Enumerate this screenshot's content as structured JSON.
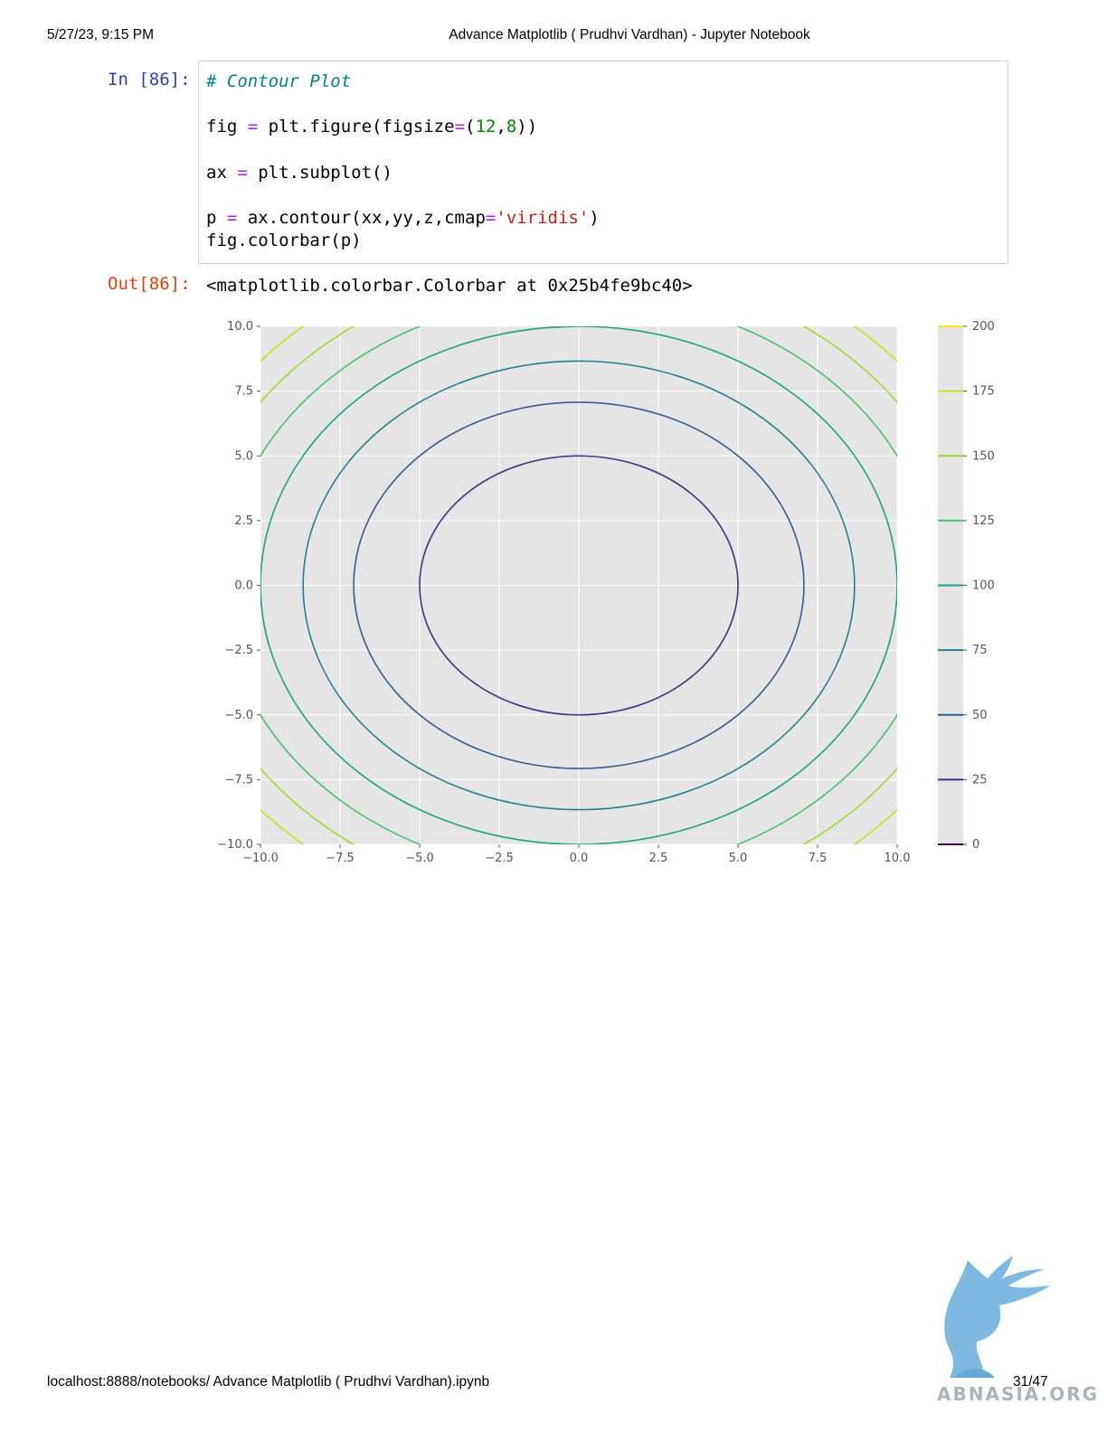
{
  "print_header": {
    "date": "5/27/23, 9:15 PM",
    "title": "Advance Matplotlib ( Prudhvi Vardhan) - Jupyter Notebook"
  },
  "cell": {
    "in_prompt": "In [86]:",
    "out_prompt": "Out[86]:",
    "output_text": "<matplotlib.colorbar.Colorbar at 0x25b4fe9bc40>"
  },
  "print_footer": {
    "url": "localhost:8888/notebooks/ Advance Matplotlib ( Prudhvi Vardhan).ipynb",
    "page": "31/47"
  },
  "watermark": {
    "text": "ABNASIA.ORG"
  },
  "chart_data": {
    "type": "contour",
    "function": "z = x^2 + y^2",
    "cmap": "viridis",
    "xlim": [
      -10,
      10
    ],
    "ylim": [
      -10,
      10
    ],
    "x_ticks": [
      "−10.0",
      "−7.5",
      "−5.0",
      "−2.5",
      "0.0",
      "2.5",
      "5.0",
      "7.5",
      "10.0"
    ],
    "y_ticks": [
      "10.0",
      "7.5",
      "5.0",
      "2.5",
      "0.0",
      "−2.5",
      "−5.0",
      "−7.5",
      "−10.0"
    ],
    "levels": [
      0,
      25,
      50,
      75,
      100,
      125,
      150,
      175,
      200
    ],
    "level_colors": [
      "#440154",
      "#46327e",
      "#365c8d",
      "#277f8e",
      "#1fa187",
      "#4ac16d",
      "#a0da39",
      "#c8e020",
      "#fde725"
    ],
    "grid": true,
    "colorbar": {
      "ticks": [
        "200",
        "175",
        "150",
        "125",
        "100",
        "75",
        "50",
        "25",
        "0"
      ]
    }
  }
}
